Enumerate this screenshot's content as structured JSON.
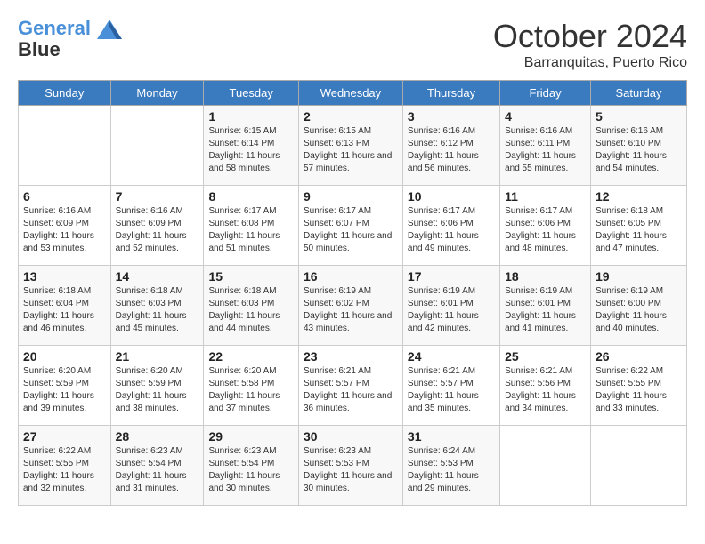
{
  "header": {
    "logo_line1": "General",
    "logo_line2": "Blue",
    "month_title": "October 2024",
    "location": "Barranquitas, Puerto Rico"
  },
  "weekdays": [
    "Sunday",
    "Monday",
    "Tuesday",
    "Wednesday",
    "Thursday",
    "Friday",
    "Saturday"
  ],
  "weeks": [
    [
      {
        "day": "",
        "sunrise": "",
        "sunset": "",
        "daylight": ""
      },
      {
        "day": "",
        "sunrise": "",
        "sunset": "",
        "daylight": ""
      },
      {
        "day": "1",
        "sunrise": "Sunrise: 6:15 AM",
        "sunset": "Sunset: 6:14 PM",
        "daylight": "Daylight: 11 hours and 58 minutes."
      },
      {
        "day": "2",
        "sunrise": "Sunrise: 6:15 AM",
        "sunset": "Sunset: 6:13 PM",
        "daylight": "Daylight: 11 hours and 57 minutes."
      },
      {
        "day": "3",
        "sunrise": "Sunrise: 6:16 AM",
        "sunset": "Sunset: 6:12 PM",
        "daylight": "Daylight: 11 hours and 56 minutes."
      },
      {
        "day": "4",
        "sunrise": "Sunrise: 6:16 AM",
        "sunset": "Sunset: 6:11 PM",
        "daylight": "Daylight: 11 hours and 55 minutes."
      },
      {
        "day": "5",
        "sunrise": "Sunrise: 6:16 AM",
        "sunset": "Sunset: 6:10 PM",
        "daylight": "Daylight: 11 hours and 54 minutes."
      }
    ],
    [
      {
        "day": "6",
        "sunrise": "Sunrise: 6:16 AM",
        "sunset": "Sunset: 6:09 PM",
        "daylight": "Daylight: 11 hours and 53 minutes."
      },
      {
        "day": "7",
        "sunrise": "Sunrise: 6:16 AM",
        "sunset": "Sunset: 6:09 PM",
        "daylight": "Daylight: 11 hours and 52 minutes."
      },
      {
        "day": "8",
        "sunrise": "Sunrise: 6:17 AM",
        "sunset": "Sunset: 6:08 PM",
        "daylight": "Daylight: 11 hours and 51 minutes."
      },
      {
        "day": "9",
        "sunrise": "Sunrise: 6:17 AM",
        "sunset": "Sunset: 6:07 PM",
        "daylight": "Daylight: 11 hours and 50 minutes."
      },
      {
        "day": "10",
        "sunrise": "Sunrise: 6:17 AM",
        "sunset": "Sunset: 6:06 PM",
        "daylight": "Daylight: 11 hours and 49 minutes."
      },
      {
        "day": "11",
        "sunrise": "Sunrise: 6:17 AM",
        "sunset": "Sunset: 6:06 PM",
        "daylight": "Daylight: 11 hours and 48 minutes."
      },
      {
        "day": "12",
        "sunrise": "Sunrise: 6:18 AM",
        "sunset": "Sunset: 6:05 PM",
        "daylight": "Daylight: 11 hours and 47 minutes."
      }
    ],
    [
      {
        "day": "13",
        "sunrise": "Sunrise: 6:18 AM",
        "sunset": "Sunset: 6:04 PM",
        "daylight": "Daylight: 11 hours and 46 minutes."
      },
      {
        "day": "14",
        "sunrise": "Sunrise: 6:18 AM",
        "sunset": "Sunset: 6:03 PM",
        "daylight": "Daylight: 11 hours and 45 minutes."
      },
      {
        "day": "15",
        "sunrise": "Sunrise: 6:18 AM",
        "sunset": "Sunset: 6:03 PM",
        "daylight": "Daylight: 11 hours and 44 minutes."
      },
      {
        "day": "16",
        "sunrise": "Sunrise: 6:19 AM",
        "sunset": "Sunset: 6:02 PM",
        "daylight": "Daylight: 11 hours and 43 minutes."
      },
      {
        "day": "17",
        "sunrise": "Sunrise: 6:19 AM",
        "sunset": "Sunset: 6:01 PM",
        "daylight": "Daylight: 11 hours and 42 minutes."
      },
      {
        "day": "18",
        "sunrise": "Sunrise: 6:19 AM",
        "sunset": "Sunset: 6:01 PM",
        "daylight": "Daylight: 11 hours and 41 minutes."
      },
      {
        "day": "19",
        "sunrise": "Sunrise: 6:19 AM",
        "sunset": "Sunset: 6:00 PM",
        "daylight": "Daylight: 11 hours and 40 minutes."
      }
    ],
    [
      {
        "day": "20",
        "sunrise": "Sunrise: 6:20 AM",
        "sunset": "Sunset: 5:59 PM",
        "daylight": "Daylight: 11 hours and 39 minutes."
      },
      {
        "day": "21",
        "sunrise": "Sunrise: 6:20 AM",
        "sunset": "Sunset: 5:59 PM",
        "daylight": "Daylight: 11 hours and 38 minutes."
      },
      {
        "day": "22",
        "sunrise": "Sunrise: 6:20 AM",
        "sunset": "Sunset: 5:58 PM",
        "daylight": "Daylight: 11 hours and 37 minutes."
      },
      {
        "day": "23",
        "sunrise": "Sunrise: 6:21 AM",
        "sunset": "Sunset: 5:57 PM",
        "daylight": "Daylight: 11 hours and 36 minutes."
      },
      {
        "day": "24",
        "sunrise": "Sunrise: 6:21 AM",
        "sunset": "Sunset: 5:57 PM",
        "daylight": "Daylight: 11 hours and 35 minutes."
      },
      {
        "day": "25",
        "sunrise": "Sunrise: 6:21 AM",
        "sunset": "Sunset: 5:56 PM",
        "daylight": "Daylight: 11 hours and 34 minutes."
      },
      {
        "day": "26",
        "sunrise": "Sunrise: 6:22 AM",
        "sunset": "Sunset: 5:55 PM",
        "daylight": "Daylight: 11 hours and 33 minutes."
      }
    ],
    [
      {
        "day": "27",
        "sunrise": "Sunrise: 6:22 AM",
        "sunset": "Sunset: 5:55 PM",
        "daylight": "Daylight: 11 hours and 32 minutes."
      },
      {
        "day": "28",
        "sunrise": "Sunrise: 6:23 AM",
        "sunset": "Sunset: 5:54 PM",
        "daylight": "Daylight: 11 hours and 31 minutes."
      },
      {
        "day": "29",
        "sunrise": "Sunrise: 6:23 AM",
        "sunset": "Sunset: 5:54 PM",
        "daylight": "Daylight: 11 hours and 30 minutes."
      },
      {
        "day": "30",
        "sunrise": "Sunrise: 6:23 AM",
        "sunset": "Sunset: 5:53 PM",
        "daylight": "Daylight: 11 hours and 30 minutes."
      },
      {
        "day": "31",
        "sunrise": "Sunrise: 6:24 AM",
        "sunset": "Sunset: 5:53 PM",
        "daylight": "Daylight: 11 hours and 29 minutes."
      },
      {
        "day": "",
        "sunrise": "",
        "sunset": "",
        "daylight": ""
      },
      {
        "day": "",
        "sunrise": "",
        "sunset": "",
        "daylight": ""
      }
    ]
  ]
}
